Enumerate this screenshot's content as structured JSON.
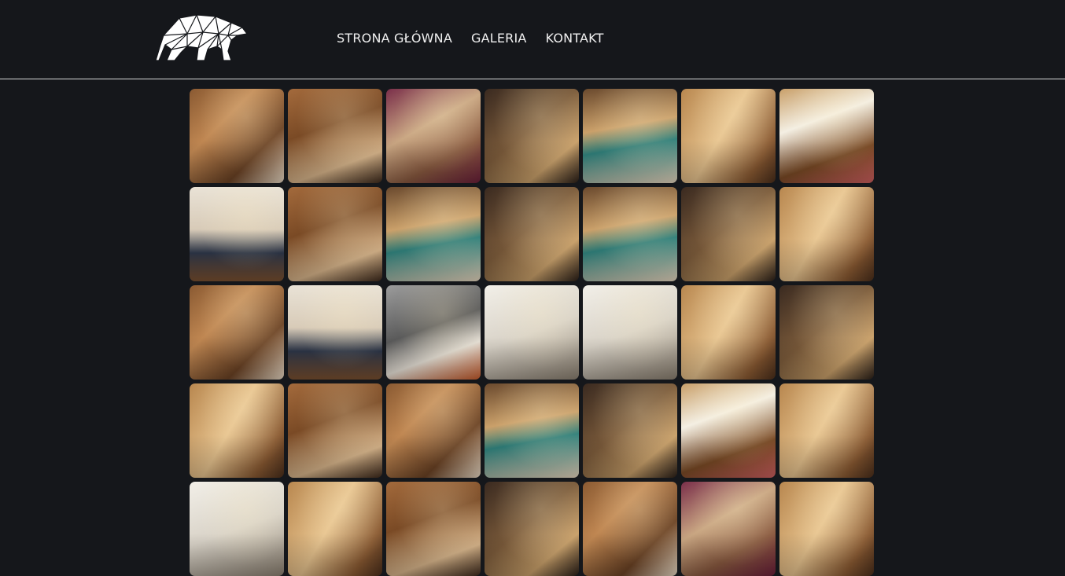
{
  "header": {
    "logo": {
      "icon": "geometric-bear-icon"
    },
    "nav": [
      {
        "label": "STRONA GŁÓWNA"
      },
      {
        "label": "GALERIA"
      },
      {
        "label": "KONTAKT"
      }
    ]
  },
  "gallery": {
    "rows": 5,
    "columns": 7,
    "thumbnails": [
      "bedroom-attic-window",
      "attic-room-window",
      "carved-cabinet",
      "dining-chairs",
      "long-dining-table",
      "carved-ceiling",
      "bedroom-heater",
      "bed-flowers",
      "dining-table-tv",
      "set-table",
      "table-pumpkin",
      "table-plates",
      "wooden-hallway",
      "antler-wall",
      "fireplace-corner",
      "bedroom-pillows",
      "bear-art-rose",
      "linen-pillows",
      "mountain-painting",
      "wooden-table-wine",
      "wooden-hall",
      "carved-cabinet-2",
      "attic-beams",
      "wooden-door",
      "tulips",
      "bedroom-curtains",
      "attic-bed",
      "attic-bed-2",
      "pillow-embroidery",
      "attic-ceiling",
      "attic-window",
      "chandelier-room",
      "lit-room",
      "fireplace-arch",
      "carved-wall"
    ]
  },
  "colors": {
    "background": "#15171b",
    "nav_text": "#f0f0f0",
    "divider": "#d8d8d8"
  }
}
